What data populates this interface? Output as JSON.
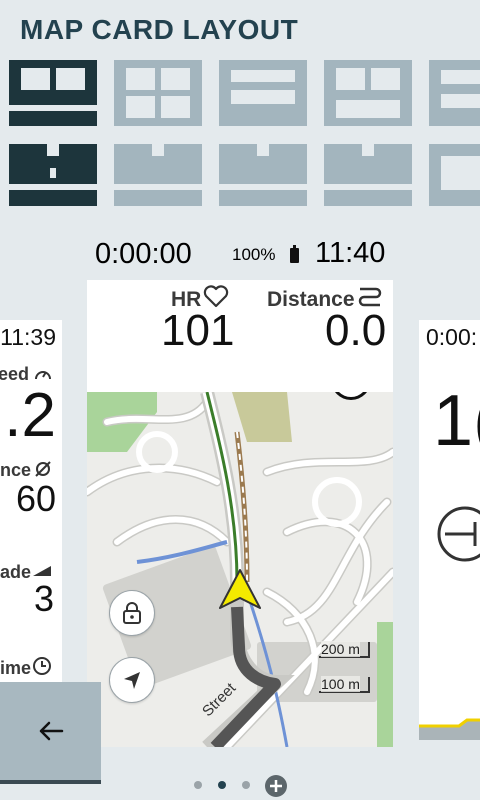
{
  "title": "MAP CARD LAYOUT",
  "colors": {
    "selected": "#1d353c",
    "unselected": "#a3b5be",
    "background": "#e4eaed",
    "heading": "#23424f"
  },
  "main_card": {
    "elapsed_time": "0:00:00",
    "battery": "100%",
    "clock": "11:40",
    "fields": [
      {
        "label": "HR",
        "icon": "heart-icon",
        "value": "101"
      },
      {
        "label": "Distance",
        "icon": "route-icon",
        "value": "0.0"
      }
    ],
    "map": {
      "street_label": "Street",
      "scale_labels": [
        "200 m",
        "100 m"
      ]
    }
  },
  "left_card": {
    "clock": "11:39",
    "fields": [
      {
        "label": "eed",
        "icon": "speedometer-icon",
        "value": ".2"
      },
      {
        "label": "nce",
        "icon": "avg-icon",
        "value": "60"
      },
      {
        "label": "ade",
        "icon": "grade-icon",
        "value": "3"
      },
      {
        "label": "ime",
        "icon": "clock-icon",
        "value": ""
      }
    ]
  },
  "right_card": {
    "time": "0:00:",
    "value": "1("
  },
  "pagination": {
    "count": 3,
    "active_index": 1
  }
}
